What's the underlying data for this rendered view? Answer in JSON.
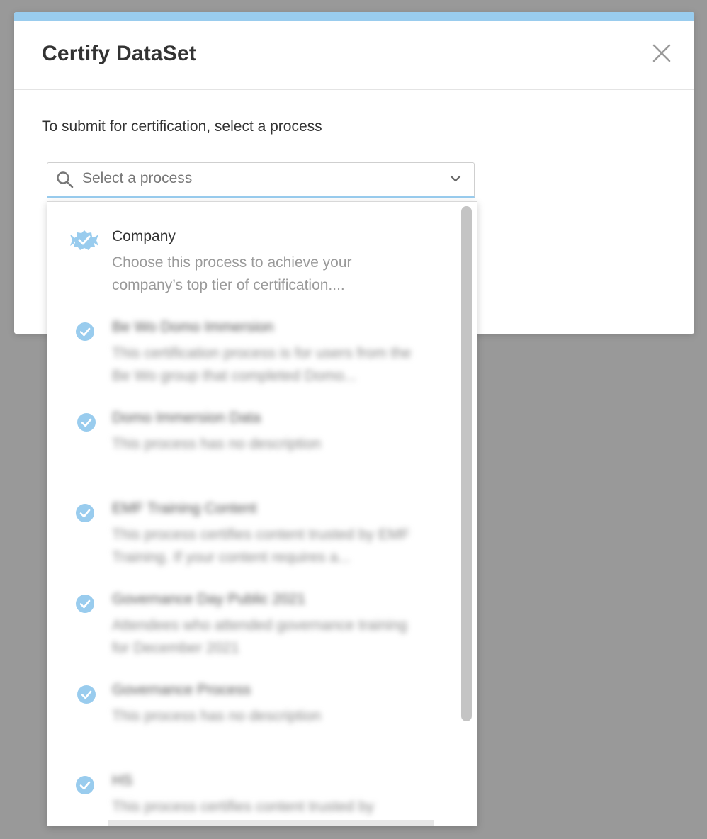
{
  "modal": {
    "title": "Certify DataSet",
    "instruction": "To submit for certification, select a process",
    "accent_color": "#99ccee"
  },
  "select": {
    "placeholder": "Select a process"
  },
  "processes": [
    {
      "name": "Company",
      "description": "Choose this process to achieve your company’s top tier of certification....",
      "icon": "certified-badge-icon",
      "blurred": false
    },
    {
      "name": "Be Wo Domo Immersion",
      "description": "This certification process is for users from the Be Wo group that completed Domo...",
      "icon": "check-circle-icon",
      "blurred": true
    },
    {
      "name": "Domo Immersion Data",
      "description": "This process has no description",
      "icon": "check-circle-icon",
      "blurred": true
    },
    {
      "name": "EMF Training Content",
      "description": "This process certifies content trusted by EMF Training. If your content requires a...",
      "icon": "check-circle-icon",
      "blurred": true
    },
    {
      "name": "Governance Day Public 2021",
      "description": "Attendees who attended governance training for December 2021",
      "icon": "check-circle-icon",
      "blurred": true
    },
    {
      "name": "Governance Process",
      "description": "This process has no description",
      "icon": "check-circle-icon",
      "blurred": true
    },
    {
      "name": "HS",
      "description": "This process certifies content trusted by",
      "icon": "check-circle-icon",
      "blurred": true
    }
  ]
}
